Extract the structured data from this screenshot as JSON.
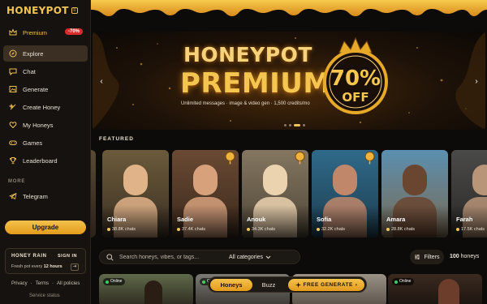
{
  "app": {
    "logo_text": "HONEYPOT",
    "logo_badge": "≡"
  },
  "sidebar": {
    "premium": {
      "label": "Premium",
      "badge": "-70%"
    },
    "items": [
      {
        "label": "Explore",
        "icon": "compass-icon",
        "active": true
      },
      {
        "label": "Chat",
        "icon": "chat-bubble-icon"
      },
      {
        "label": "Generate",
        "icon": "image-icon"
      },
      {
        "label": "Create Honey",
        "icon": "sparkle-icon"
      },
      {
        "label": "My Honeys",
        "icon": "heart-icon"
      },
      {
        "label": "Games",
        "icon": "gamepad-icon"
      },
      {
        "label": "Leaderboard",
        "icon": "trophy-icon"
      }
    ],
    "more_label": "MORE",
    "telegram_label": "Telegram",
    "upgrade_label": "Upgrade",
    "honey_rain": {
      "title": "HONEY RAIN",
      "signin": "SIGN IN",
      "subtitle_prefix": "Fresh pot every",
      "subtitle_bold": "12 hours",
      "icon": "enter-icon"
    },
    "footer": {
      "privacy": "Privacy",
      "sep1": "·",
      "terms": "Terms",
      "sep2": "·",
      "policies": "All policies",
      "status": "Service status"
    }
  },
  "banner": {
    "title_line1": "HONEYPOT",
    "title_line2": "PREMIUM",
    "subtitle": "Unlimited messages · image & video gen · 1,500 credits/mo",
    "discount_value": "70%",
    "discount_word": "OFF",
    "prev_arrow": "‹",
    "next_arrow": "›",
    "slide_count": 4,
    "active_slide": 2
  },
  "featured": {
    "label": "FEATURED",
    "cards": [
      {
        "name": "Chiara",
        "chats": "38.8K chats",
        "bg": [
          "#6b5a3b",
          "#3b3022"
        ],
        "accent": "#e0b389"
      },
      {
        "name": "Sadie",
        "chats": "37.4K chats",
        "bg": [
          "#6a4a33",
          "#3a281c"
        ],
        "accent": "#d7a17c"
      },
      {
        "name": "Anouk",
        "chats": "34.3K chats",
        "bg": [
          "#847761",
          "#4e4536"
        ],
        "accent": "#ecd3b0"
      },
      {
        "name": "Sofia",
        "chats": "32.2K chats",
        "bg": [
          "#2f6a8a",
          "#1e3d4f"
        ],
        "accent": "#c0876a"
      },
      {
        "name": "Amara",
        "chats": "28.8K chats",
        "bg": [
          "#5b8fb0",
          "#7a6a52"
        ],
        "accent": "#6a4530"
      },
      {
        "name": "Farah",
        "chats": "17.5K chats",
        "bg": [
          "#4a4a48",
          "#2a2826"
        ],
        "accent": "#b89478"
      }
    ]
  },
  "search": {
    "placeholder": "Search honeys, vibes, or tags...",
    "category_value": "All categories",
    "filters_label": "Filters",
    "count_number": "100",
    "count_word": "honeys"
  },
  "grid": {
    "online_label": "Online"
  },
  "bottom_bar": {
    "tab_honeys": "Honeys",
    "tab_buzz": "Buzz",
    "free_generate": "FREE GENERATE",
    "free_arrow": "›"
  },
  "colors": {
    "accent_gold": "#f2c253",
    "badge_red": "#d92b2b",
    "online_green": "#36d35e"
  }
}
